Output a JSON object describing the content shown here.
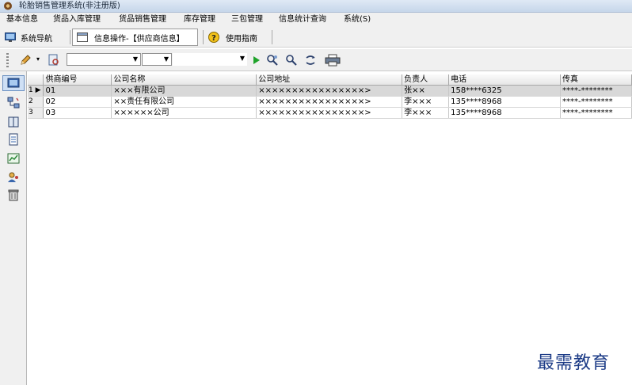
{
  "window": {
    "title": "轮胎销售管理系统(非注册版)"
  },
  "menu": [
    "基本信息",
    "货品入库管理",
    "货品销售管理",
    "库存管理",
    "三包管理",
    "信息统计查询",
    "系统(S)"
  ],
  "tabs": {
    "nav_label": "系统导航",
    "active_label": "信息操作-【供应商信息】",
    "help_label": "使用指南"
  },
  "toolbar": {
    "combo1_value": "",
    "combo2_value": "",
    "combo3_value": ""
  },
  "table": {
    "columns": [
      "供商编号",
      "公司名称",
      "公司地址",
      "负责人",
      "电话",
      "传真"
    ],
    "rows": [
      {
        "num": "1",
        "current": true,
        "cells": [
          "01",
          "×××有限公司",
          "××××××××××××××××>",
          "张××",
          "158****6325",
          "****-********"
        ]
      },
      {
        "num": "2",
        "current": false,
        "cells": [
          "02",
          "××责任有限公司",
          "××××××××××××××××>",
          "李×××",
          "135****8968",
          "****-********"
        ]
      },
      {
        "num": "3",
        "current": false,
        "cells": [
          "03",
          "××××××公司",
          "××××××××××××××××>",
          "李×××",
          "135****8968",
          "****-********"
        ]
      }
    ]
  },
  "watermark": "最需教育"
}
